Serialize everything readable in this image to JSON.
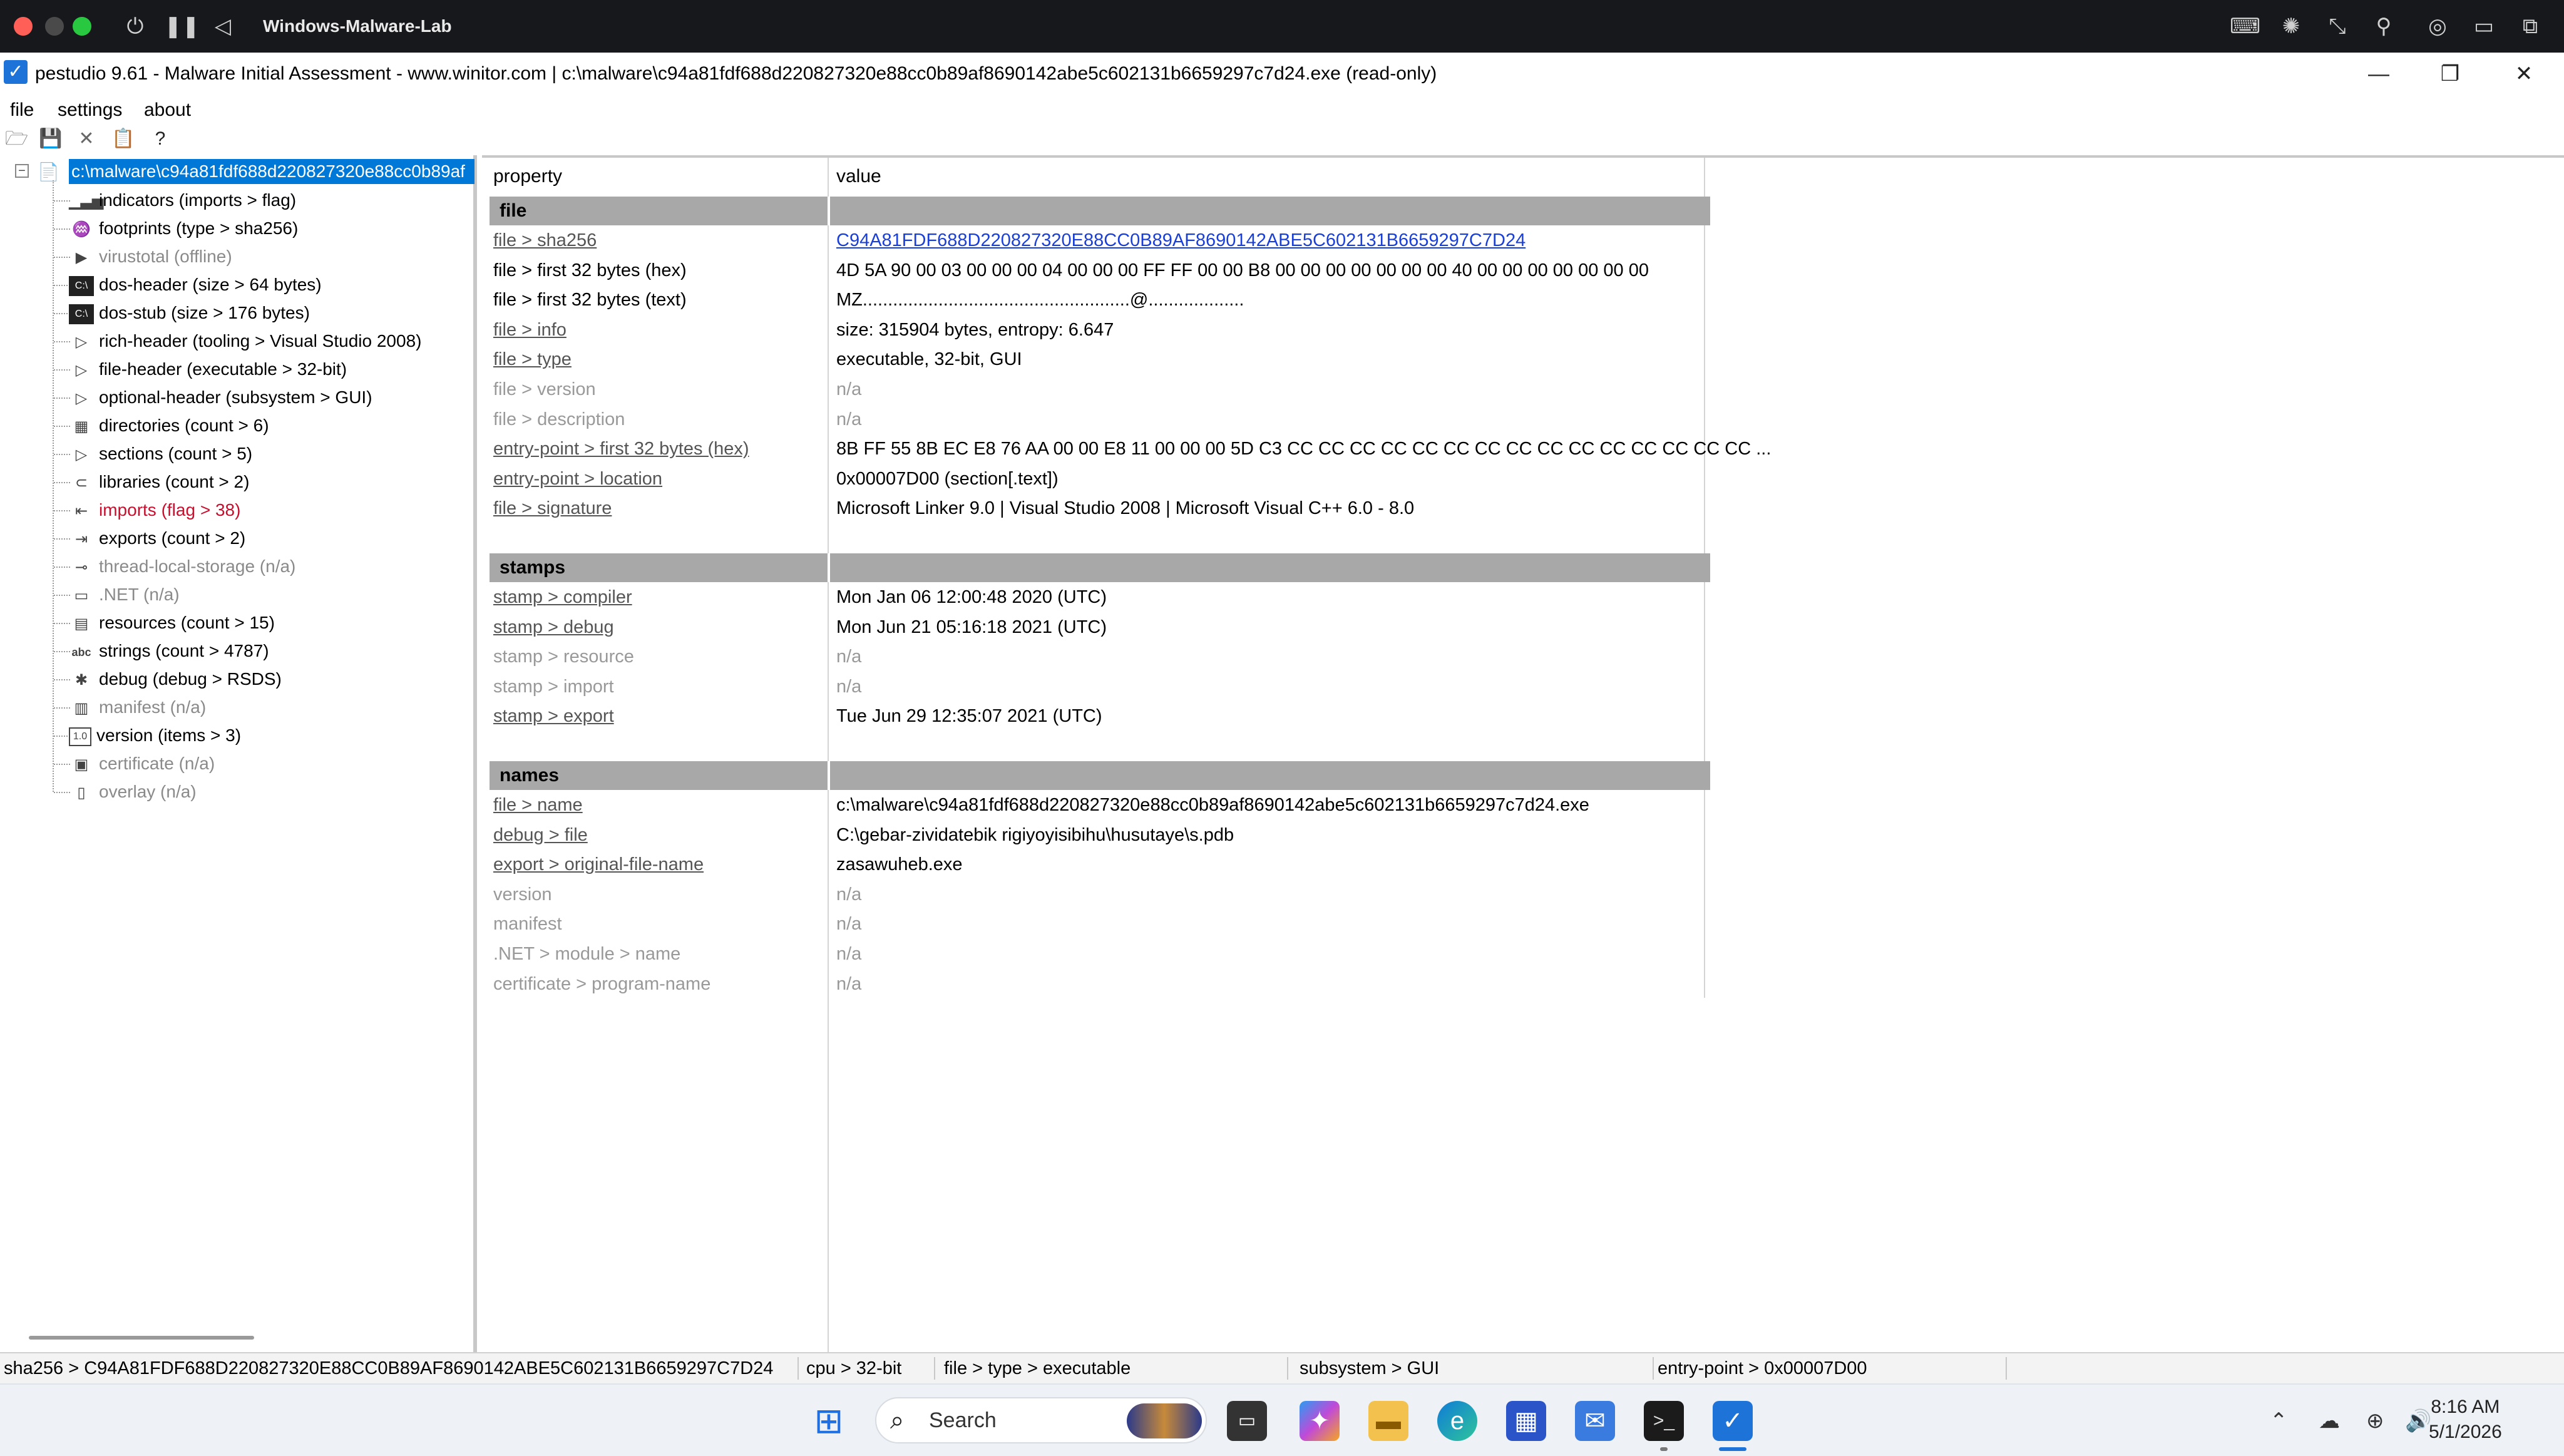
{
  "vm": {
    "title": "Windows-Malware-Lab"
  },
  "colors": {
    "selection": "#0078d7",
    "section_band": "#a8a8a8",
    "flag_red": "#c8102e",
    "link_blue": "#1a3fd6"
  },
  "window": {
    "title": "pestudio 9.61 - Malware Initial Assessment - www.winitor.com | c:\\malware\\c94a81fdf688d220827320e88cc0b89af8690142abe5c602131b6659297c7d24.exe (read-only)"
  },
  "menu": {
    "file": "file",
    "settings": "settings",
    "about": "about"
  },
  "tree": {
    "root": "c:\\malware\\c94a81fdf688d220827320e88cc0b89af",
    "items": [
      {
        "label": "indicators (imports > flag)",
        "icon": "chart-icon"
      },
      {
        "label": "footprints (type > sha256)",
        "icon": "footprint-icon"
      },
      {
        "label": "virustotal (offline)",
        "icon": "virustotal-icon"
      },
      {
        "label": "dos-header (size > 64 bytes)",
        "icon": "console-icon"
      },
      {
        "label": "dos-stub (size > 176 bytes)",
        "icon": "console-icon"
      },
      {
        "label": "rich-header (tooling > Visual Studio 2008)",
        "icon": "expand-icon"
      },
      {
        "label": "file-header (executable > 32-bit)",
        "icon": "expand-icon"
      },
      {
        "label": "optional-header (subsystem > GUI)",
        "icon": "expand-icon"
      },
      {
        "label": "directories (count > 6)",
        "icon": "grid-icon"
      },
      {
        "label": "sections (count > 5)",
        "icon": "expand-icon"
      },
      {
        "label": "libraries (count > 2)",
        "icon": "library-icon"
      },
      {
        "label": "imports (flag > 38)",
        "icon": "imports-icon"
      },
      {
        "label": "exports (count > 2)",
        "icon": "exports-icon"
      },
      {
        "label": "thread-local-storage (n/a)",
        "icon": "tls-icon"
      },
      {
        "label": ".NET (n/a)",
        "icon": "dotnet-icon"
      },
      {
        "label": "resources (count > 15)",
        "icon": "resources-icon"
      },
      {
        "label": "strings (count > 4787)",
        "icon": "strings-icon"
      },
      {
        "label": "debug (debug > RSDS)",
        "icon": "debug-icon"
      },
      {
        "label": "manifest (n/a)",
        "icon": "manifest-icon"
      },
      {
        "label": "version (items > 3)",
        "icon": "version-icon"
      },
      {
        "label": "certificate (n/a)",
        "icon": "certificate-icon"
      },
      {
        "label": "overlay (n/a)",
        "icon": "overlay-icon"
      }
    ],
    "icon_glyphs": {
      "chart": "▁▃▅",
      "footprint": "♒",
      "virustotal": "▶",
      "console": "C:\\",
      "expand": "▷",
      "grid": "▦",
      "library": "⊂",
      "imports": "⇤",
      "exports": "⇥",
      "tls": "⊸",
      "dotnet": "▭",
      "resources": "▤",
      "strings": "abc",
      "debug": "✱",
      "manifest": "▥",
      "version": "1.0",
      "certificate": "▣",
      "overlay": "▯"
    }
  },
  "table": {
    "headers": {
      "property": "property",
      "value": "value"
    },
    "sections": [
      {
        "name": "file",
        "rows": [
          {
            "property": "file > sha256",
            "value": "C94A81FDF688D220827320E88CC0B89AF8690142ABE5C602131B6659297C7D24",
            "style": "link"
          },
          {
            "property": "file > first 32 bytes (hex)",
            "value": "4D 5A 90 00 03 00 00 00 04 00 00 00 FF FF 00 00 B8 00 00 00 00 00 00 00 40 00 00 00 00 00 00 00",
            "style": "plain"
          },
          {
            "property": "file > first 32 bytes (text)",
            "value": "MZ.....................................................@...................",
            "style": "plain"
          },
          {
            "property": "file > info",
            "value": "size: 315904 bytes, entropy: 6.647",
            "style": "underline"
          },
          {
            "property": "file > type",
            "value": "executable, 32-bit, GUI",
            "style": "underline"
          },
          {
            "property": "file > version",
            "value": "n/a",
            "style": "off"
          },
          {
            "property": "file > description",
            "value": "n/a",
            "style": "off"
          },
          {
            "property": "entry-point > first 32 bytes (hex)",
            "value": "8B FF 55 8B EC E8 76 AA 00 00 E8 11 00 00 00 5D C3 CC CC CC CC CC CC CC CC CC CC CC CC CC CC CC ...",
            "style": "underline"
          },
          {
            "property": "entry-point > location",
            "value": "0x00007D00 (section[.text])",
            "style": "underline"
          },
          {
            "property": "file > signature",
            "value": "Microsoft Linker 9.0 | Visual Studio 2008 | Microsoft Visual C++ 6.0 - 8.0",
            "style": "underline"
          }
        ]
      },
      {
        "name": "stamps",
        "rows": [
          {
            "property": "stamp > compiler",
            "value": "Mon Jan 06 12:00:48 2020 (UTC)",
            "style": "underline"
          },
          {
            "property": "stamp > debug",
            "value": "Mon Jun 21 05:16:18 2021 (UTC)",
            "style": "underline"
          },
          {
            "property": "stamp > resource",
            "value": "n/a",
            "style": "off"
          },
          {
            "property": "stamp > import",
            "value": "n/a",
            "style": "off"
          },
          {
            "property": "stamp > export",
            "value": "Tue Jun 29 12:35:07 2021 (UTC)",
            "style": "underline"
          }
        ]
      },
      {
        "name": "names",
        "rows": [
          {
            "property": "file > name",
            "value": "c:\\malware\\c94a81fdf688d220827320e88cc0b89af8690142abe5c602131b6659297c7d24.exe",
            "style": "underline"
          },
          {
            "property": "debug > file",
            "value": "C:\\gebar-zividatebik rigiyoyisibihu\\husutaye\\s.pdb",
            "style": "underline"
          },
          {
            "property": "export > original-file-name",
            "value": "zasawuheb.exe",
            "style": "underline"
          },
          {
            "property": "version",
            "value": "n/a",
            "style": "off"
          },
          {
            "property": "manifest",
            "value": "n/a",
            "style": "off"
          },
          {
            "property": ".NET > module > name",
            "value": "n/a",
            "style": "off"
          },
          {
            "property": "certificate > program-name",
            "value": "n/a",
            "style": "off"
          }
        ]
      }
    ]
  },
  "status": {
    "sha256": "sha256 > C94A81FDF688D220827320E88CC0B89AF8690142ABE5C602131B6659297C7D24",
    "cpu": "cpu > 32-bit",
    "type": "file > type > executable",
    "subsystem": "subsystem > GUI",
    "entry_point": "entry-point > 0x00007D00"
  },
  "taskbar": {
    "search_label": "Search",
    "clock_time": "8:16 AM",
    "clock_date": "5/1/2026"
  }
}
